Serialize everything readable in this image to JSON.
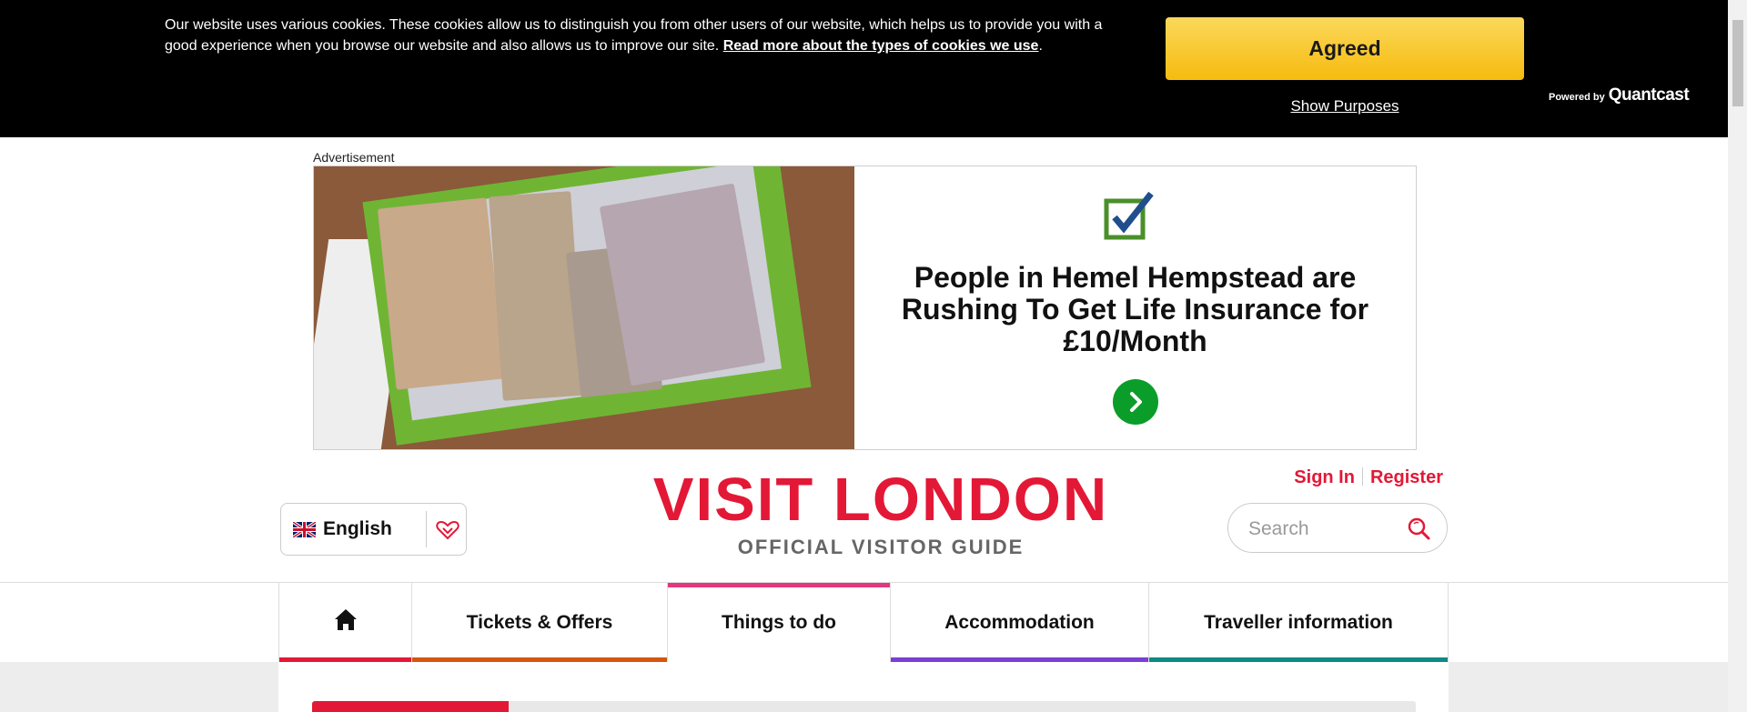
{
  "cookie_banner": {
    "text": "Our website uses various cookies. These cookies allow us to distinguish you from other users of our website, which helps us to provide you with a good experience when you browse our website and also allows us to improve our site.",
    "link_text": "Read more about the types of cookies we use",
    "link_suffix": ".",
    "agree_label": "Agreed",
    "purposes_label": "Show Purposes",
    "powered_by": "Powered by",
    "powered_brand": "Quantcast"
  },
  "ad": {
    "label": "Advertisement",
    "headline": "People in Hemel Hempstead are Rushing To Get Life Insurance for £10/Month"
  },
  "header": {
    "language": "English",
    "logo": "VISIT LONDON",
    "tagline": "OFFICIAL VISITOR GUIDE",
    "sign_in": "Sign In",
    "register": "Register",
    "search_placeholder": "Search"
  },
  "nav": {
    "items": [
      {
        "label": "",
        "icon": "home-icon",
        "color": "#e31836"
      },
      {
        "label": "Tickets & Offers",
        "color": "#d4560f"
      },
      {
        "label": "Things to do",
        "color": "#e3377f",
        "active": true
      },
      {
        "label": "Accommodation",
        "color": "#7b3fd6"
      },
      {
        "label": "Traveller information",
        "color": "#0d8a84"
      }
    ]
  },
  "colors": {
    "brand_red": "#e31836",
    "agree_yellow": "#f9c930",
    "ad_green": "#0a9d2a"
  }
}
